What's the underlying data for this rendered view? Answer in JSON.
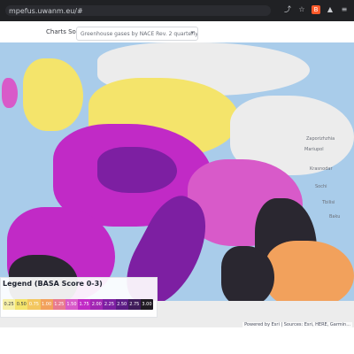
{
  "browser": {
    "address": "mpefus.uwanm.eu/#",
    "icons": [
      "share-icon",
      "star-icon",
      "brave-icon",
      "warning-icon",
      "menu-icon"
    ]
  },
  "header": {
    "charts_source_label": "Charts Source:",
    "select_value": "Greenhouse gases by NACE Rev. 2 quarterly"
  },
  "map": {
    "labels": [
      "Zaporizhzhia",
      "Mariupol",
      "Krasnodar",
      "Sochi",
      "Tbilisi",
      "Baku"
    ],
    "colors": {
      "sea": "#a9ccea",
      "low": "#f4e46b",
      "mid": "#c12ac6",
      "high": "#2a2730"
    }
  },
  "legend": {
    "title": "Legend (BASA Score 0-3)",
    "ticks": [
      "0.25",
      "0.50",
      "0.75",
      "1.00",
      "1.25",
      "1.50",
      "1.75",
      "2.00",
      "2.25",
      "2.50",
      "2.75",
      "3.00"
    ],
    "tick_colors": [
      "#f6f0a8",
      "#f4e46b",
      "#f3c75f",
      "#f2a15c",
      "#e87a8f",
      "#d85ac9",
      "#c12ac6",
      "#a226b3",
      "#7d1fa2",
      "#5b1b84",
      "#3f1b5a",
      "#1f1a22"
    ]
  },
  "attribution": "Powered by Esri | Sources: Esri, HERE, Garmin..."
}
